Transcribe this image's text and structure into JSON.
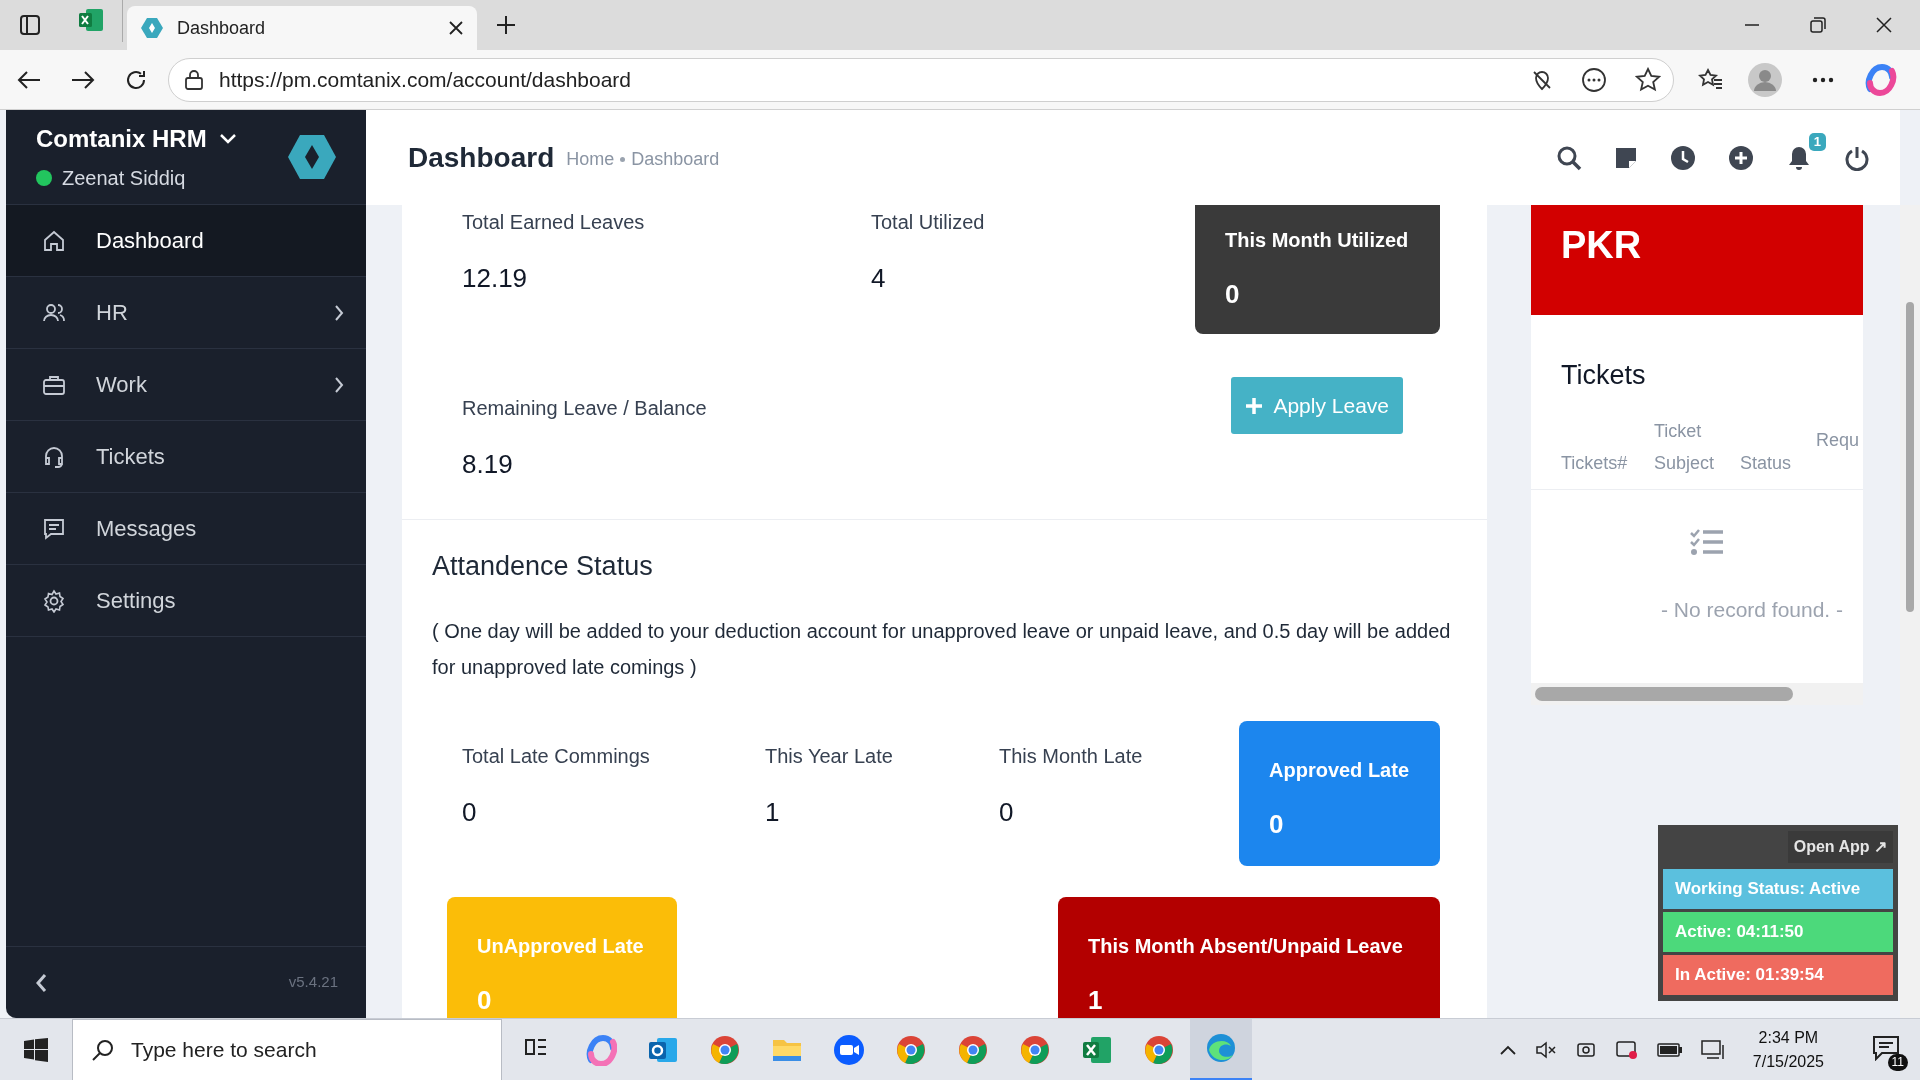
{
  "browser": {
    "tabs": [
      {
        "kind": "sheet",
        "selected": false
      },
      {
        "kind": "page",
        "label": "Dashboard",
        "selected": true
      }
    ],
    "url": "https://pm.comtanix.com/account/dashboard"
  },
  "sidebar": {
    "brand": "Comtanix HRM",
    "user": "Zeenat Siddiq",
    "online": true,
    "items": [
      {
        "kind": "home",
        "label": "Dashboard",
        "selected": true,
        "expandable": false
      },
      {
        "kind": "users",
        "label": "HR",
        "selected": false,
        "expandable": true
      },
      {
        "kind": "briefcase",
        "label": "Work",
        "selected": false,
        "expandable": true
      },
      {
        "kind": "headset",
        "label": "Tickets",
        "selected": false,
        "expandable": false
      },
      {
        "kind": "message",
        "label": "Messages",
        "selected": false,
        "expandable": false
      },
      {
        "kind": "gear",
        "label": "Settings",
        "selected": false,
        "expandable": false
      }
    ],
    "version": "v5.4.21"
  },
  "header": {
    "title": "Dashboard",
    "breadcrumb": [
      "Home",
      "Dashboard"
    ],
    "notification_count": "1"
  },
  "leave": {
    "stats": [
      {
        "label": "Total Earned Leaves",
        "value": "12.19"
      },
      {
        "label": "Total Utilized",
        "value": "4"
      }
    ],
    "this_month": {
      "label": "This Month Utilized",
      "value": "0"
    },
    "remaining": {
      "label": "Remaining Leave / Balance",
      "value": "8.19"
    },
    "apply_button": "Apply Leave"
  },
  "attendance": {
    "title": "Attandence Status",
    "note": "( One day will be added to your deduction account for unapproved leave or unpaid leave, and 0.5 day will be added for unapproved late comings )",
    "stats": [
      {
        "label": "Total Late Commings",
        "value": "0"
      },
      {
        "label": "This Year Late",
        "value": "1"
      },
      {
        "label": "This Month Late",
        "value": "0"
      }
    ],
    "cards": [
      {
        "label": "Approved Late",
        "value": "0",
        "color": "#1c86ee"
      },
      {
        "label": "UnApproved Late",
        "value": "0",
        "color": "#fbbd08"
      },
      {
        "label": "This Month Absent/Unpaid Leave",
        "value": "1",
        "color": "#b30000"
      }
    ]
  },
  "fine": {
    "text": "PKR"
  },
  "tickets": {
    "title": "Tickets",
    "columns": [
      "Tickets#",
      "Ticket Subject",
      "Status",
      "Requ"
    ],
    "empty": "- No record found. -"
  },
  "tracker": {
    "open_app": "Open App ↗",
    "rows": [
      {
        "text": "Working Status: Active",
        "color": "#5bc0de"
      },
      {
        "text": "Active: 04:11:50",
        "color": "#4cd97b"
      },
      {
        "text": "In Active: 01:39:54",
        "color": "#ef6b5f"
      }
    ]
  },
  "taskbar": {
    "search_placeholder": "Type here to search",
    "apps": [
      {
        "kind": "taskview",
        "selected": false
      },
      {
        "kind": "swirl",
        "selected": false
      },
      {
        "kind": "mail",
        "selected": false
      },
      {
        "kind": "wheel",
        "selected": false
      },
      {
        "kind": "folder",
        "selected": false
      },
      {
        "kind": "camera",
        "selected": false
      },
      {
        "kind": "wheel",
        "selected": false
      },
      {
        "kind": "wheel",
        "selected": false
      },
      {
        "kind": "wheel",
        "selected": false
      },
      {
        "kind": "sheet",
        "selected": false
      },
      {
        "kind": "wheel",
        "selected": false
      },
      {
        "kind": "wave",
        "selected": true
      }
    ],
    "time": "2:34 PM",
    "date": "7/15/2025",
    "notification_count": "11"
  }
}
